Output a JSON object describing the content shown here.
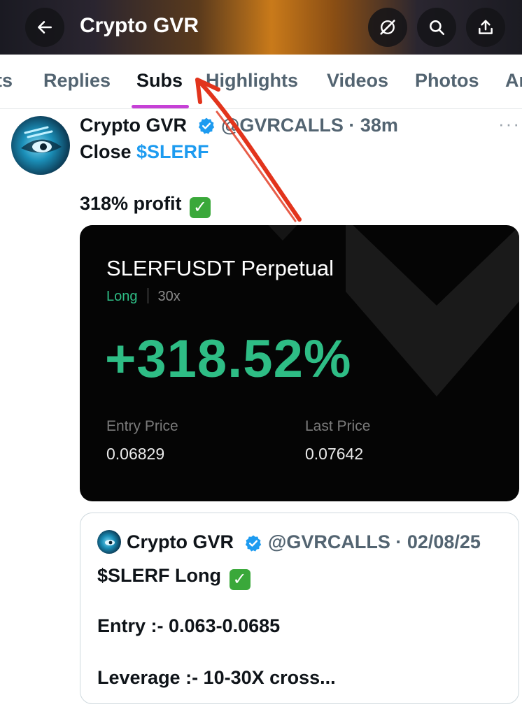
{
  "header": {
    "title": "Crypto GVR",
    "icons": [
      "back-arrow-icon",
      "grok-icon",
      "search-icon",
      "share-icon"
    ]
  },
  "tabs": [
    {
      "label": "ts",
      "active": false
    },
    {
      "label": "Replies",
      "active": false
    },
    {
      "label": "Subs",
      "active": true
    },
    {
      "label": "Highlights",
      "active": false
    },
    {
      "label": "Videos",
      "active": false
    },
    {
      "label": "Photos",
      "active": false
    },
    {
      "label": "Ar",
      "active": false
    }
  ],
  "tweet": {
    "name": "Crypto GVR",
    "handle_time": "@GVRCALLS · 38m",
    "more": "···",
    "line1_prefix": "Close ",
    "cashtag": "$SLERF",
    "line2": "318% profit",
    "checkmark": "✓"
  },
  "card": {
    "title": "SLERFUSDT Perpetual",
    "side": "Long",
    "leverage": "30x",
    "pnl_pct": "+318.52%",
    "entry_label": "Entry Price",
    "entry_value": "0.06829",
    "last_label": "Last Price",
    "last_value": "0.07642"
  },
  "quote": {
    "name": "Crypto GVR",
    "handle_date": "@GVRCALLS · 02/08/25",
    "line1": "$SLERF Long",
    "line2": "Entry :- 0.063-0.0685",
    "line3": "Leverage :- 10-30X cross..."
  },
  "colors": {
    "accent_tab": "#c640d6",
    "profit_green": "#2ebd85",
    "cashtag_blue": "#1d9bf0",
    "verified_blue": "#1d9bf0",
    "annotation_red": "#e2341c"
  }
}
